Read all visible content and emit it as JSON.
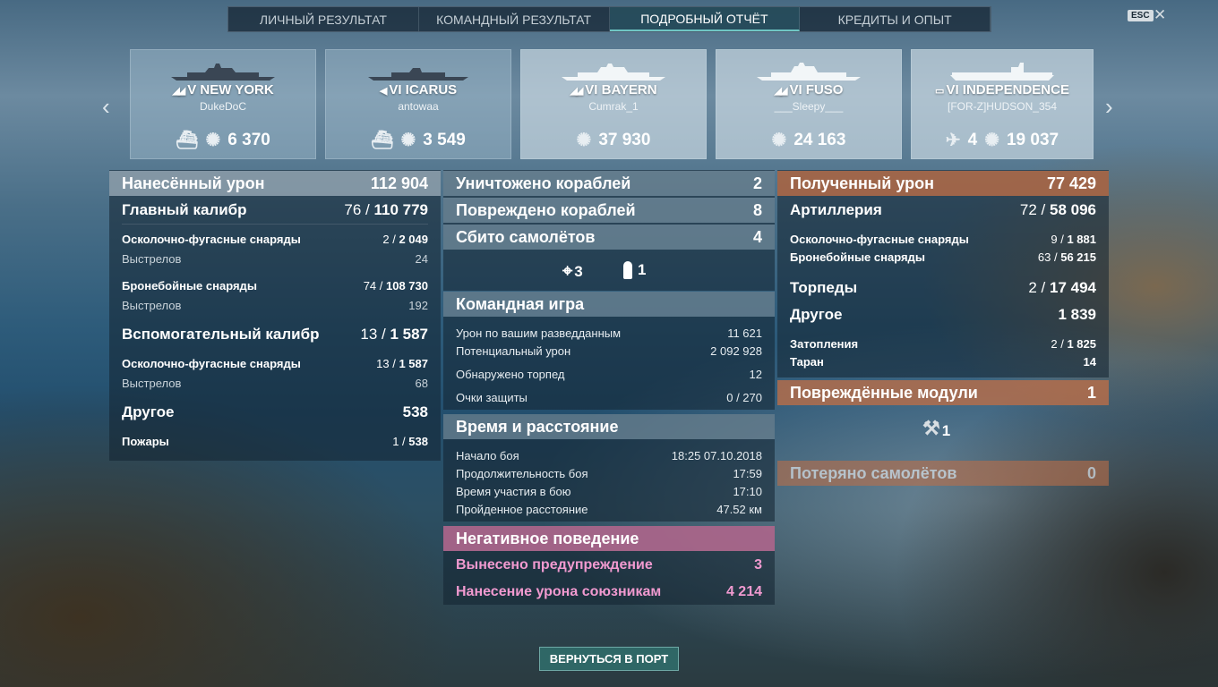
{
  "tabs": [
    "ЛИЧНЫЙ РЕЗУЛЬТАТ",
    "КОМАНДНЫЙ РЕЗУЛЬТАТ",
    "ПОДРОБНЫЙ ОТЧЁТ",
    "КРЕДИТЫ И ОПЫТ"
  ],
  "active_tab": 2,
  "esc_label": "ESC",
  "close_glyph": "✕",
  "arrow_left": "‹",
  "arrow_right": "›",
  "ships": [
    {
      "tier": "V",
      "name": "NEW YORK",
      "label": "V NEW YORK",
      "player": "DukeDoC",
      "stat1": "",
      "stat2": "6 370",
      "icon1": "sunk-ship-icon",
      "icon2": "damage-icon",
      "class": "battleship"
    },
    {
      "tier": "VI",
      "name": "ICARUS",
      "label": "VI ICARUS",
      "player": "antowaa",
      "stat1": "",
      "stat2": "3 549",
      "icon1": "sunk-ship-icon",
      "icon2": "damage-icon",
      "class": "destroyer"
    },
    {
      "tier": "VI",
      "name": "BAYERN",
      "label": "VI BAYERN",
      "player": "Cumrak_1",
      "stat1": "",
      "stat2": "37 930",
      "icon1": "",
      "icon2": "damage-icon",
      "class": "battleship"
    },
    {
      "tier": "VI",
      "name": "FUSO",
      "label": "VI FUSO",
      "player": "___Sleepy___",
      "stat1": "",
      "stat2": "24 163",
      "icon1": "",
      "icon2": "damage-icon",
      "class": "battleship"
    },
    {
      "tier": "VI",
      "name": "INDEPENDENCE",
      "label": "VI INDEPENDENCE",
      "player": "[FOR-Z]HUDSON_354",
      "stat1": "4",
      "stat2": "19 037",
      "icon1": "planes-shot-icon",
      "icon2": "damage-icon",
      "class": "carrier"
    }
  ],
  "left": {
    "dealt": {
      "label": "Нанесённый урон",
      "value": "112 904"
    },
    "main": {
      "label": "Главный калибр",
      "hits": "76 /",
      "value": "110 779"
    },
    "main_he": {
      "label": "Осколочно-фугасные снаряды",
      "hits": "2 /",
      "value": "2 049"
    },
    "main_he_shots": {
      "label": "Выстрелов",
      "value": "24"
    },
    "main_ap": {
      "label": "Бронебойные снаряды",
      "hits": "74 /",
      "value": "108 730"
    },
    "main_ap_shots": {
      "label": "Выстрелов",
      "value": "192"
    },
    "secondary": {
      "label": "Вспомогательный калибр",
      "hits": "13 /",
      "value": "1 587"
    },
    "sec_he": {
      "label": "Осколочно-фугасные снаряды",
      "hits": "13 /",
      "value": "1 587"
    },
    "sec_shots": {
      "label": "Выстрелов",
      "value": "68"
    },
    "other": {
      "label": "Другое",
      "value": "538"
    },
    "fires": {
      "label": "Пожары",
      "hits": "1 /",
      "value": "538"
    }
  },
  "center": {
    "destroyed": {
      "label": "Уничтожено кораблей",
      "value": "2"
    },
    "damaged": {
      "label": "Повреждено кораблей",
      "value": "8"
    },
    "planes": {
      "label": "Сбито самолётов",
      "value": "4"
    },
    "icons": {
      "crosshair": "3",
      "flag": "1"
    },
    "team": {
      "label": "Командная игра"
    },
    "spot_dmg": {
      "label": "Урон по вашим разведданным",
      "value": "11 621"
    },
    "potential": {
      "label": "Потенциальный урон",
      "value": "2 092 928"
    },
    "torp_spotted": {
      "label": "Обнаружено торпед",
      "value": "12"
    },
    "defense": {
      "label": "Очки защиты",
      "value": "0 / 270"
    },
    "time": {
      "label": "Время и расстояние"
    },
    "start": {
      "label": "Начало боя",
      "value": "18:25  07.10.2018"
    },
    "duration": {
      "label": "Продолжительность боя",
      "value": "17:59"
    },
    "participation": {
      "label": "Время участия в бою",
      "value": "17:10"
    },
    "distance": {
      "label": "Пройденное расстояние",
      "value": "47.52 км"
    },
    "negative": {
      "label": "Негативное поведение"
    },
    "warning": {
      "label": "Вынесено предупреждение",
      "value": "3"
    },
    "team_dmg": {
      "label": "Нанесение урона союзникам",
      "value": "4 214"
    }
  },
  "right": {
    "received": {
      "label": "Полученный урон",
      "value": "77 429"
    },
    "artillery": {
      "label": "Артиллерия",
      "hits": "72 /",
      "value": "58 096"
    },
    "art_he": {
      "label": "Осколочно-фугасные снаряды",
      "hits": "9 /",
      "value": "1 881"
    },
    "art_ap": {
      "label": "Бронебойные снаряды",
      "hits": "63 /",
      "value": "56 215"
    },
    "torps": {
      "label": "Торпеды",
      "hits": "2 /",
      "value": "17 494"
    },
    "other": {
      "label": "Другое",
      "value": "1 839"
    },
    "flooding": {
      "label": "Затопления",
      "hits": "2 /",
      "value": "1 825"
    },
    "ram": {
      "label": "Таран",
      "value": "14"
    },
    "modules": {
      "label": "Повреждённые модули",
      "value": "1"
    },
    "module_count": "1",
    "planes_lost": {
      "label": "Потеряно самолётов",
      "value": "0"
    }
  },
  "back_button": "ВЕРНУТЬСЯ В ПОРТ"
}
